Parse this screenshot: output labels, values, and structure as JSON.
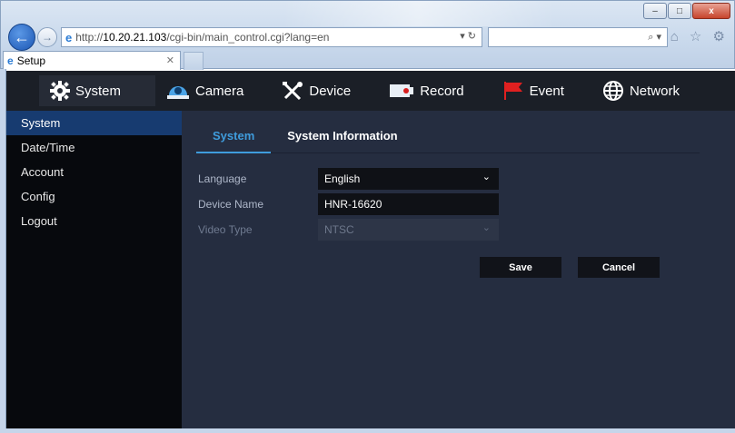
{
  "browser": {
    "tab_title": "Setup",
    "address_prefix": "http://",
    "address_host": "10.20.21.103",
    "address_path": "/cgi-bin/main_control.cgi?lang=en",
    "address_controls": "▾ ↻",
    "search_controls": "⌕ ▾",
    "toolbar_icons": "⌂ ☆ ⚙",
    "window_buttons": {
      "minimize": "–",
      "maximize": "□",
      "close": "x"
    }
  },
  "topnav": {
    "items": [
      {
        "label": "System",
        "icon": "gear-icon"
      },
      {
        "label": "Camera",
        "icon": "camera-icon"
      },
      {
        "label": "Device",
        "icon": "tools-icon"
      },
      {
        "label": "Record",
        "icon": "record-icon"
      },
      {
        "label": "Event",
        "icon": "flag-icon"
      },
      {
        "label": "Network",
        "icon": "globe-icon"
      }
    ]
  },
  "sidebar": {
    "items": [
      {
        "label": "System"
      },
      {
        "label": "Date/Time"
      },
      {
        "label": "Account"
      },
      {
        "label": "Config"
      },
      {
        "label": "Logout"
      }
    ]
  },
  "main": {
    "tabs": [
      {
        "label": "System"
      },
      {
        "label": "System Information"
      }
    ],
    "form": {
      "language": {
        "label": "Language",
        "value": "English"
      },
      "device_name": {
        "label": "Device Name",
        "value": "HNR-16620"
      },
      "video_type": {
        "label": "Video Type",
        "value": "NTSC"
      }
    },
    "buttons": {
      "save": "Save",
      "cancel": "Cancel"
    }
  },
  "colors": {
    "accent": "#3f9cdc",
    "active_sidebar": "#173b70",
    "panel_bg": "#252d40",
    "nav_bg": "#1b1f27"
  }
}
